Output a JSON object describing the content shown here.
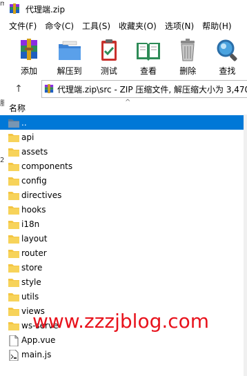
{
  "window": {
    "title": "代理端.zip"
  },
  "menubar": [
    "文件(F)",
    "命令(C)",
    "工具(S)",
    "收藏夹(O)",
    "选项(N)",
    "帮助(H)"
  ],
  "toolbar": [
    {
      "label": "添加",
      "icon": "add-archive-icon"
    },
    {
      "label": "解压到",
      "icon": "extract-to-icon"
    },
    {
      "label": "测试",
      "icon": "test-icon"
    },
    {
      "label": "查看",
      "icon": "view-book-icon"
    },
    {
      "label": "删除",
      "icon": "delete-trash-icon"
    },
    {
      "label": "查找",
      "icon": "find-magnifier-icon"
    }
  ],
  "address": {
    "up_arrow": "↑",
    "path": "代理端.zip\\src - ZIP 压缩文件, 解压缩大小为 3,470"
  },
  "list": {
    "column_name": "名称",
    "sort_indicator": "^",
    "items": [
      {
        "name": "..",
        "type": "parent",
        "selected": true
      },
      {
        "name": "api",
        "type": "folder"
      },
      {
        "name": "assets",
        "type": "folder"
      },
      {
        "name": "components",
        "type": "folder"
      },
      {
        "name": "config",
        "type": "folder"
      },
      {
        "name": "directives",
        "type": "folder"
      },
      {
        "name": "hooks",
        "type": "folder"
      },
      {
        "name": "i18n",
        "type": "folder"
      },
      {
        "name": "layout",
        "type": "folder"
      },
      {
        "name": "router",
        "type": "folder"
      },
      {
        "name": "store",
        "type": "folder"
      },
      {
        "name": "style",
        "type": "folder"
      },
      {
        "name": "utils",
        "type": "folder"
      },
      {
        "name": "views",
        "type": "folder"
      },
      {
        "name": "ws-serve",
        "type": "folder"
      },
      {
        "name": "App.vue",
        "type": "file"
      },
      {
        "name": "main.js",
        "type": "jsfile"
      }
    ]
  },
  "left_edge_glyphs": [
    "m",
    "服",
    "2"
  ],
  "watermark": "www.zzzjblog.com",
  "colors": {
    "selection": "#0078d7",
    "folder": "#f4c542",
    "watermark": "#e8121c"
  }
}
